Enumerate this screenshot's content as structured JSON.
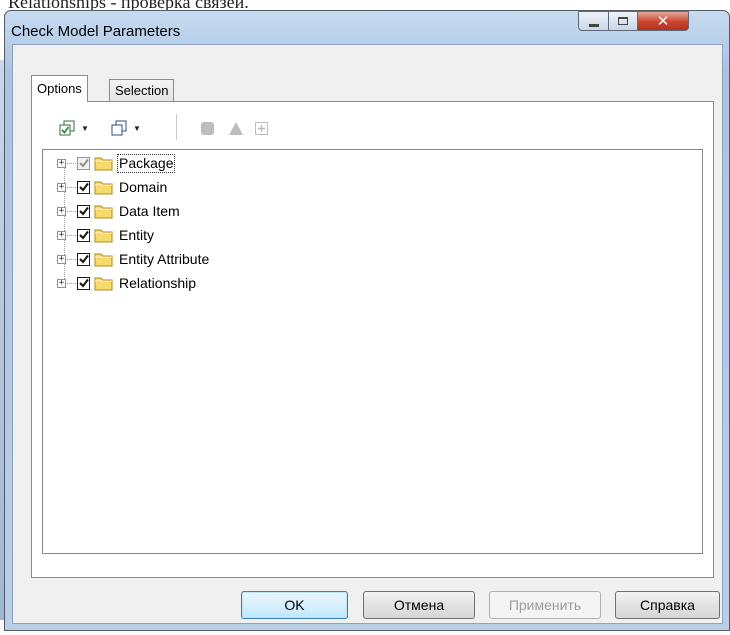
{
  "background": {
    "text": "Relationships - проверка связей."
  },
  "window": {
    "title": "Check Model Parameters",
    "controls": {
      "minimize": "minimize-icon",
      "maximize": "maximize-icon",
      "close": "close-icon"
    }
  },
  "tabs": [
    {
      "label": "Options",
      "active": true
    },
    {
      "label": "Selection",
      "active": false
    }
  ],
  "toolbar": {
    "items": [
      "select-all-icon",
      "dropdown-arrow-icon",
      "deselect-all-icon",
      "dropdown-arrow-icon",
      "stop-icon",
      "warning-icon",
      "expand-icon"
    ]
  },
  "tree": {
    "items": [
      {
        "label": "Package",
        "checked": true,
        "dimmed": true
      },
      {
        "label": "Domain",
        "checked": true
      },
      {
        "label": "Data Item",
        "checked": true
      },
      {
        "label": "Entity",
        "checked": true
      },
      {
        "label": "Entity Attribute",
        "checked": true
      },
      {
        "label": "Relationship",
        "checked": true
      }
    ]
  },
  "buttons": {
    "ok": "OK",
    "cancel": "Отмена",
    "apply": "Применить",
    "help": "Справка"
  },
  "colors": {
    "accent": "#3c7fb1",
    "close": "#c9432c",
    "folder": "#f6d96b"
  }
}
